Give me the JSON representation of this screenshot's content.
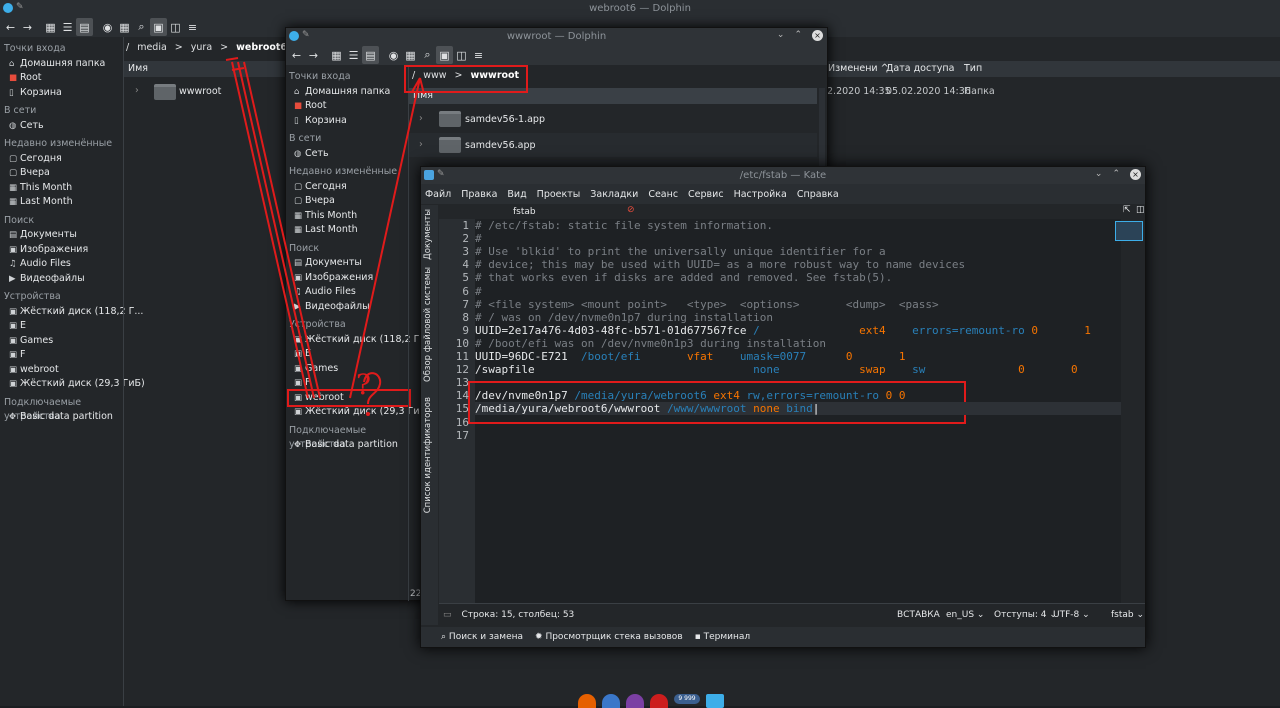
{
  "window1": {
    "title": "webroot6 — Dolphin",
    "breadcrumb": {
      "sep1": "/",
      "p1": "media",
      "sep2": ">",
      "p2": "yura",
      "sep3": ">",
      "current": "webroot6"
    },
    "columns": {
      "name": "Имя",
      "modified": "Изменени",
      "accessed": "Дата доступа",
      "type": "Тип"
    },
    "row": {
      "name": "wwwroot",
      "modified": "2.2020 14:35",
      "accessed": "05.02.2020 14:36",
      "type": "Папка"
    }
  },
  "sidebar": {
    "places_header": "Точки входа",
    "home": "Домашняя папка",
    "root": "Root",
    "trash": "Корзина",
    "network_header": "В сети",
    "network": "Сеть",
    "recent_header": "Недавно изменённые",
    "today": "Сегодня",
    "yesterday": "Вчера",
    "this_month": "This Month",
    "last_month": "Last Month",
    "search_header": "Поиск",
    "documents": "Документы",
    "images": "Изображения",
    "audio": "Audio Files",
    "video": "Видеофайлы",
    "devices_header": "Устройства",
    "disk1": "Жёсткий диск (118,2 Г...",
    "e": "E",
    "games": "Games",
    "f": "F",
    "webroot": "webroot",
    "disk2": "Жёсткий диск (29,3 ГиБ)",
    "removable_header": "Подключаемые устройства",
    "basic": "Basic data partition"
  },
  "window2": {
    "title": "wwwroot — Dolphin",
    "breadcrumb": {
      "sep1": "/",
      "p1": "www",
      "sep2": ">",
      "current": "wwwroot"
    },
    "column_name": "Имя",
    "items": [
      "samdev56-1.app",
      "samdev56.app"
    ],
    "status_num": "22",
    "disk1": "Жёсткий диск (118,2 Г...",
    "e": "E",
    "f": "F"
  },
  "kate": {
    "title": "/etc/fstab — Kate",
    "menu": [
      "Файл",
      "Правка",
      "Вид",
      "Проекты",
      "Закладки",
      "Сеанс",
      "Сервис",
      "Настройка",
      "Справка"
    ],
    "tab": "fstab",
    "vtabs": {
      "documents": "Документы",
      "filesystem": "Обзор файловой системы",
      "symbols": "Список идентификаторов"
    },
    "lines": [
      "# /etc/fstab: static file system information.",
      "#",
      "# Use 'blkid' to print the universally unique identifier for a",
      "# device; this may be used with UUID= as a more robust way to name devices",
      "# that works even if disks are added and removed. See fstab(5).",
      "#",
      "# <file system> <mount point>   <type>  <options>       <dump>  <pass>",
      "# / was on /dev/nvme0n1p7 during installation",
      "UUID=2e17a476-4d03-48fc-b571-01d677567fce /               ext4    errors=remount-ro 0       1",
      "# /boot/efi was on /dev/nvme0n1p3 during installation",
      "UUID=96DC-E721  /boot/efi       vfat    umask=0077      0       1",
      "/swapfile                                 none            swap    sw              0       0",
      "",
      "/dev/nvme0n1p7 /media/yura/webroot6 ext4 rw,errors=remount-ro 0 0",
      "/media/yura/webroot6/wwwroot /www/wwwroot none bind",
      "",
      ""
    ],
    "line_numbers": [
      "1",
      "2",
      "3",
      "4",
      "5",
      "6",
      "7",
      "8",
      "9",
      "10",
      "11",
      "12",
      "13",
      "14",
      "15",
      "16",
      "17"
    ],
    "status": {
      "position": "Строка: 15, столбец: 53",
      "mode": "ВСТАВКА",
      "lang": "en_US",
      "indent": "Отступы: 4",
      "encoding": "UTF-8",
      "filetype": "fstab"
    },
    "tools": {
      "search": "Поиск и замена",
      "stack": "Просмотрщик стека вызовов",
      "terminal": "Терминал"
    }
  },
  "annotation": {
    "question": "?"
  },
  "taskbar": {
    "badge": "9 999"
  }
}
